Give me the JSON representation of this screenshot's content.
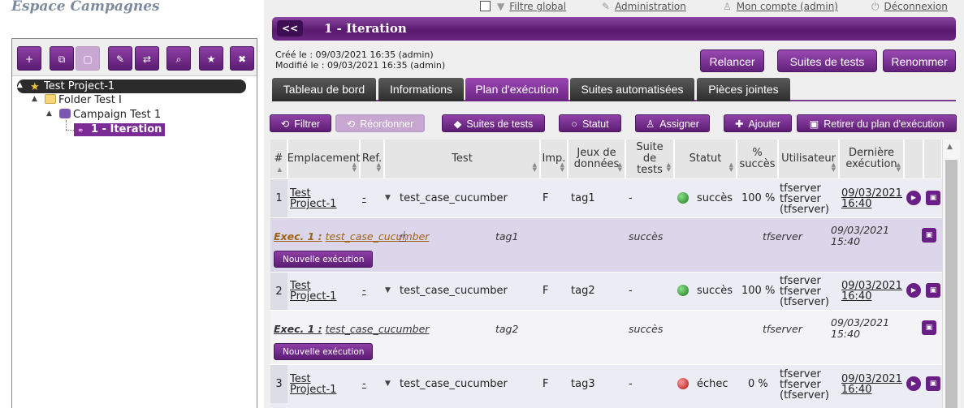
{
  "space_title": "Espace Campagnes",
  "toolbar": {
    "buttons": [
      {
        "icon": "plus-icon",
        "glyph": "+"
      },
      {
        "icon": "copy-icon",
        "glyph": "⧉"
      },
      {
        "icon": "paste-icon",
        "glyph": "📋",
        "disabled": true
      },
      {
        "icon": "rename-icon",
        "glyph": "✎"
      },
      {
        "icon": "move-icon",
        "glyph": "⇄"
      },
      {
        "icon": "search-icon",
        "glyph": "⌕"
      },
      {
        "icon": "star-icon",
        "glyph": "★"
      },
      {
        "icon": "trash-icon",
        "glyph": "🗑"
      }
    ]
  },
  "tree": {
    "project": "Test Project-1",
    "folder": "Folder Test I",
    "campaign": "Campaign Test 1",
    "iteration": "1 - Iteration"
  },
  "topbar": {
    "filter": "Filtre global",
    "admin": "Administration",
    "account": "Mon compte (admin)",
    "logout": "Déconnexion"
  },
  "header": {
    "back": "<<",
    "title": "1 - Iteration"
  },
  "meta": {
    "created": "Créé le :  09/03/2021 16:35 (admin)",
    "modified": "Modifié le :  09/03/2021 16:35 (admin)"
  },
  "actions": {
    "relaunch": "Relancer",
    "suites": "Suites de tests",
    "rename": "Renommer"
  },
  "tabs": [
    "Tableau de bord",
    "Informations",
    "Plan d'exécution",
    "Suites automatisées",
    "Pièces jointes"
  ],
  "plan_buttons": {
    "filter": "Filtrer",
    "reorder": "Réordonner",
    "suites": "Suites de tests",
    "status": "Statut",
    "assign": "Assigner",
    "add": "Ajouter",
    "remove": "Retirer du plan d'exécution"
  },
  "columns": {
    "num": "#",
    "location": "Emplacement",
    "ref": "Ref.",
    "test": "Test",
    "imp": "Imp.",
    "datasets": "Jeux de données",
    "suite": "Suite de tests",
    "status": "Statut",
    "success": "% succès",
    "user": "Utilisateur",
    "last_exec": "Dernière exécution"
  },
  "rows": [
    {
      "num": "1",
      "loc1": "Test",
      "loc2": "Project-1",
      "ref": "-",
      "test": "test_case_cucumber",
      "imp": "F",
      "dataset": "tag1",
      "suite": "-",
      "status": "succès",
      "status_color": "#2f9e2f",
      "pct": "100 %",
      "user1": "tfserver",
      "user2": "tfserver",
      "user3": "(tfserver)",
      "date": "09/03/2021",
      "time": "16:40",
      "exec": {
        "label": "Exec. 1 :",
        "test": "test_case_cucumber",
        "tag": "tag1",
        "status": "succès",
        "user": "tfserver",
        "date": "09/03/2021",
        "time": "15:40",
        "button": "Nouvelle exécution"
      }
    },
    {
      "num": "2",
      "loc1": "Test",
      "loc2": "Project-1",
      "ref": "-",
      "test": "test_case_cucumber",
      "imp": "F",
      "dataset": "tag2",
      "suite": "-",
      "status": "succès",
      "status_color": "#2f9e2f",
      "pct": "100 %",
      "user1": "tfserver",
      "user2": "tfserver",
      "user3": "(tfserver)",
      "date": "09/03/2021",
      "time": "16:40",
      "exec": {
        "label": "Exec. 1 :",
        "test": "test_case_cucumber",
        "tag": "tag2",
        "status": "succès",
        "user": "tfserver",
        "date": "09/03/2021",
        "time": "15:40",
        "button": "Nouvelle exécution"
      }
    },
    {
      "num": "3",
      "loc1": "Test",
      "loc2": "Project-1",
      "ref": "-",
      "test": "test_case_cucumber",
      "imp": "F",
      "dataset": "tag3",
      "suite": "-",
      "status": "échec",
      "status_color": "#d42020",
      "pct": "0 %",
      "user1": "tfserver",
      "user2": "tfserver",
      "user3": "(tfserver)",
      "date": "09/03/2021",
      "time": "16:40"
    }
  ]
}
